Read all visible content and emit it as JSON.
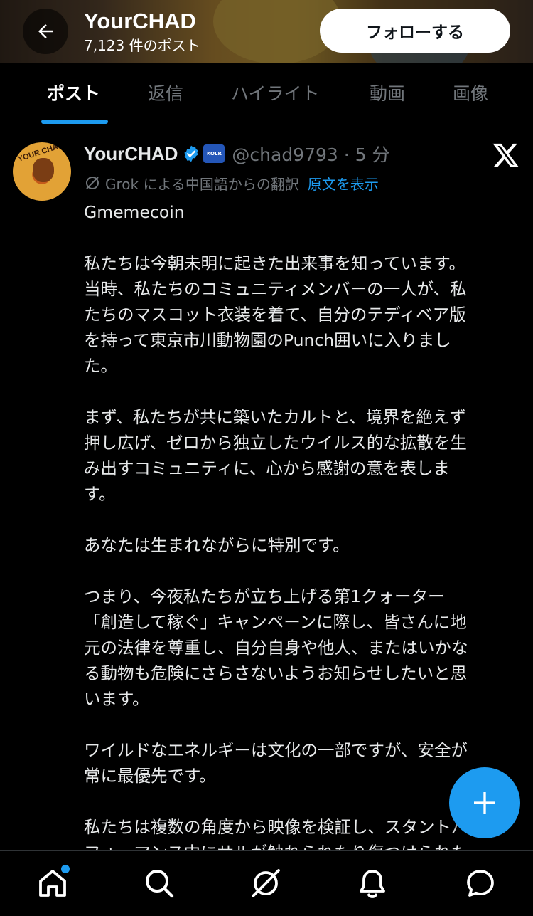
{
  "header": {
    "title": "YourCHAD",
    "post_count": "7,123 件のポスト",
    "follow_label": "フォローする"
  },
  "tabs": [
    {
      "label": "ポスト",
      "active": true
    },
    {
      "label": "返信",
      "active": false
    },
    {
      "label": "ハイライト",
      "active": false
    },
    {
      "label": "動画",
      "active": false
    },
    {
      "label": "画像",
      "active": false
    }
  ],
  "post": {
    "avatar_text": "YOUR CHAD",
    "author_name": "YourCHAD",
    "affiliate_badge": "KOLR",
    "handle_time": "@chad9793 · 5 分",
    "translation_note": "Grok による中国語からの翻訳",
    "show_original": "原文を表示",
    "paragraphs": [
      "Gmemecoin",
      "私たちは今朝未明に起きた出来事を知っています。\n当時、私たちのコミュニティメンバーの一人が、私\nたちのマスコット衣装を着て、自分のテディベア版\nを持って東京市川動物園のPunch囲いに入りまし\nた。",
      "まず、私たちが共に築いたカルトと、境界を絶えず\n押し広げ、ゼロから独立したウイルス的な拡散を生\nみ出すコミュニティに、心から感謝の意を表しま\nす。",
      "あなたは生まれながらに特別です。",
      "つまり、今夜私たちが立ち上げる第1クォーター\n「創造して稼ぐ」キャンペーンに際し、皆さんに地\n元の法律を尊重し、自分自身や他人、またはいかな\nる動物も危険にさらさないようお知らせしたいと思\nいます。",
      "ワイルドなエネルギーは文化の一部ですが、安全が\n常に最優先です。",
      "私たちは複数の角度から映像を検証し、スタントパ\nフォーマンス中にサルが触れられたり傷つけられた"
    ]
  },
  "colors": {
    "accent": "#1d9bf0",
    "background": "#000000",
    "secondary_text": "#71767b"
  },
  "nav": {
    "items": [
      "home-icon",
      "search-icon",
      "grok-icon",
      "notifications-icon",
      "messages-icon"
    ]
  }
}
